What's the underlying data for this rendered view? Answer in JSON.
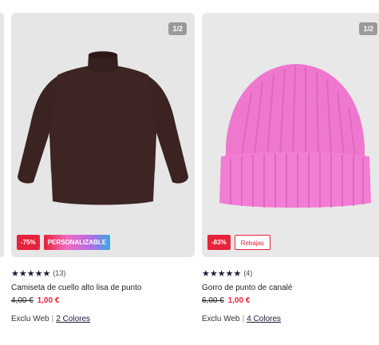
{
  "products": [
    {
      "image_counter": "1/2",
      "badges": {
        "discount": "-75%",
        "extra": "PERSONALIZABLE"
      },
      "rating_stars": "★★★★★",
      "review_count": "(13)",
      "title": "Camiseta de cuello alto lisa de punto",
      "old_price": "4,00 €",
      "new_price": "1,00 €",
      "tag": "Exclu Web",
      "separator": "|",
      "colors": "2 Colores",
      "image_colors": {
        "garment": "#3d2523",
        "background": "#e6e6e6"
      }
    },
    {
      "image_counter": "1/2",
      "badges": {
        "discount": "-83%",
        "extra": "Rebajas"
      },
      "rating_stars": "★★★★★",
      "review_count": "(4)",
      "title": "Gorro de punto de canalé",
      "old_price": "6,00 €",
      "new_price": "1,00 €",
      "tag": "Exclu Web",
      "separator": "|",
      "colors": "4 Colores",
      "image_colors": {
        "garment": "#f07ad0",
        "background": "#e8e8e8"
      }
    }
  ],
  "colors": {
    "accent_red": "#e5233a",
    "star": "#1a1a3a"
  }
}
